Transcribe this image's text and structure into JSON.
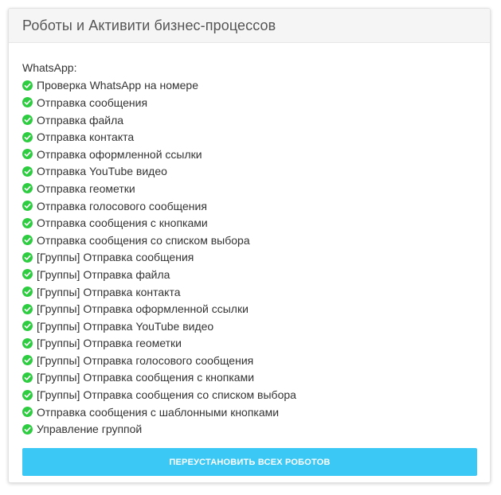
{
  "card": {
    "title": "Роботы и Активити бизнес-процессов"
  },
  "section": {
    "label": "WhatsApp:"
  },
  "features": [
    "Проверка WhatsApp на номере",
    "Отправка сообщения",
    "Отправка файла",
    "Отправка контакта",
    "Отправка оформленной ссылки",
    "Отправка YouTube видео",
    "Отправка геометки",
    "Отправка голосового сообщения",
    "Отправка сообщения с кнопками",
    "Отправка сообщения со списком выбора",
    "[Группы] Отправка сообщения",
    "[Группы] Отправка файла",
    "[Группы] Отправка контакта",
    "[Группы] Отправка оформленной ссылки",
    "[Группы] Отправка YouTube видео",
    "[Группы] Отправка геометки",
    "[Группы] Отправка голосового сообщения",
    "[Группы] Отправка сообщения с кнопками",
    "[Группы] Отправка сообщения со списком выбора",
    "Отправка сообщения с шаблонными кнопками",
    "Управление группой"
  ],
  "feature_icon": "check-circle-icon",
  "action": {
    "reinstall_label": "ПЕРЕУСТАНОВИТЬ ВСЕХ РОБОТОВ"
  },
  "colors": {
    "check": "#2ecc40",
    "button": "#3bc8f5",
    "header_bg": "#f5f5f5"
  }
}
